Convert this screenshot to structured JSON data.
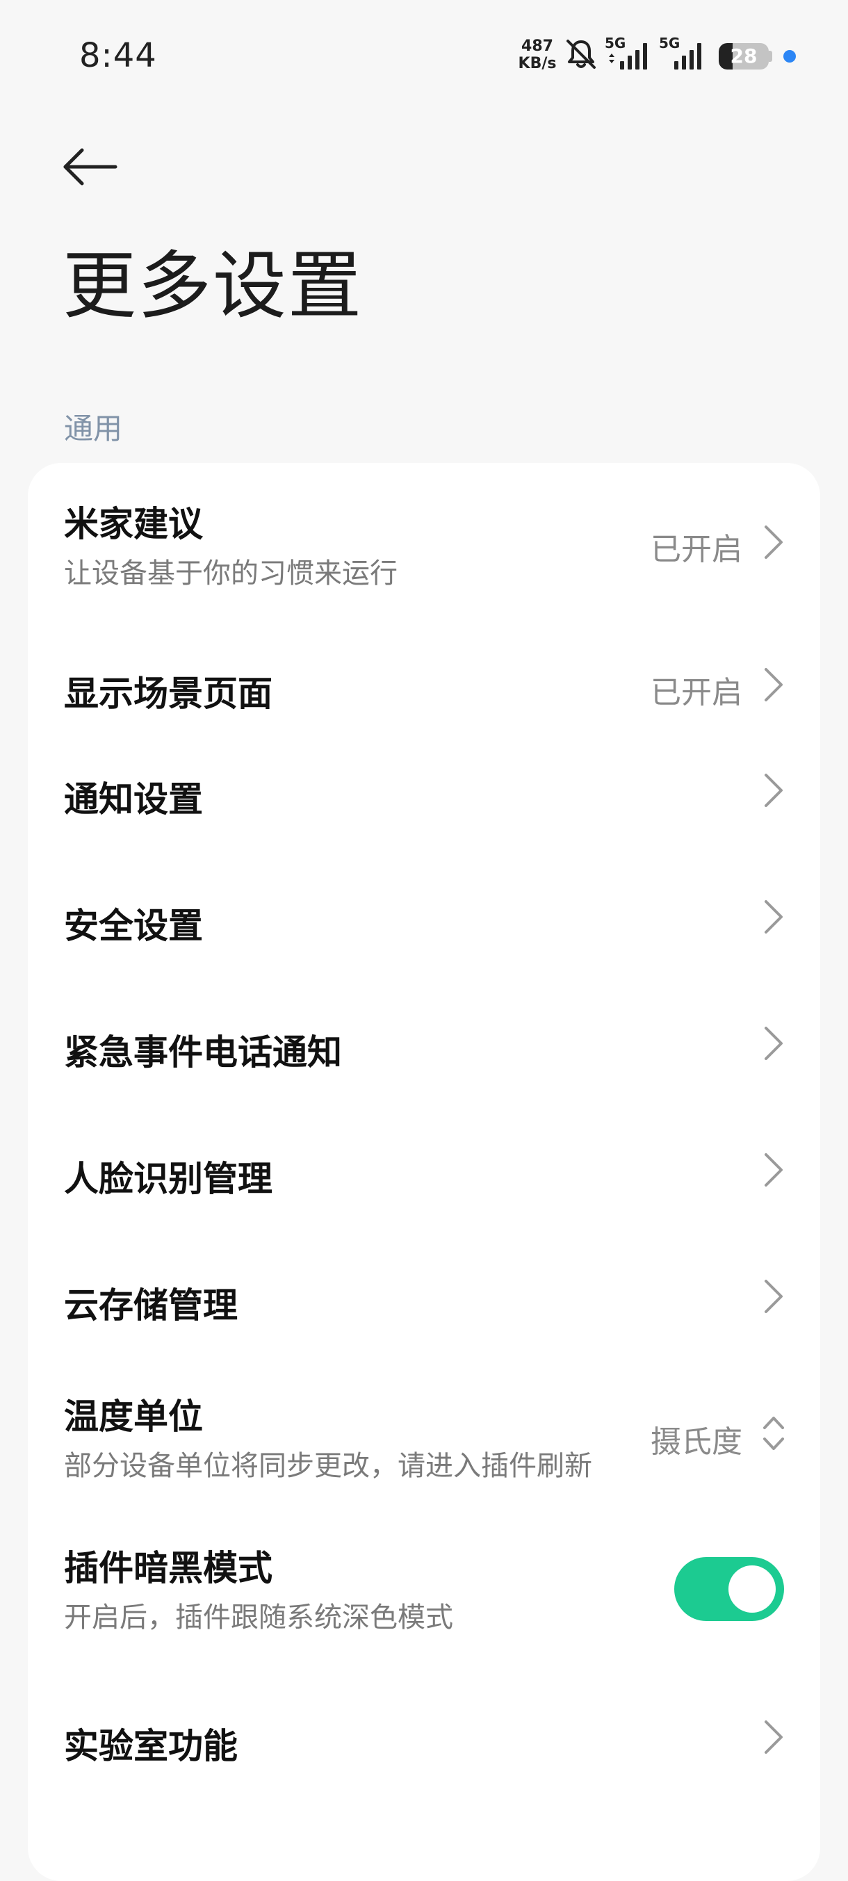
{
  "status_bar": {
    "time": "8:44",
    "net_speed_value": "487",
    "net_speed_unit": "KB/s",
    "sim1_label": "5G",
    "sim2_label": "5G",
    "battery_level": "28",
    "battery_fraction": 0.28,
    "accent_dot_color": "#2c86f5",
    "icons": [
      "bell-off-icon",
      "signal-icon",
      "signal-icon",
      "battery-icon"
    ]
  },
  "header": {
    "back_icon": "arrow-left-icon",
    "title": "更多设置"
  },
  "section": {
    "label": "通用"
  },
  "rows": [
    {
      "title": "米家建议",
      "subtitle": "让设备基于你的习惯来运行",
      "value": "已开启",
      "control": "chevron"
    },
    {
      "title": "显示场景页面",
      "value": "已开启",
      "control": "chevron"
    },
    {
      "title": "通知设置",
      "control": "chevron"
    },
    {
      "title": "安全设置",
      "control": "chevron"
    },
    {
      "title": "紧急事件电话通知",
      "control": "chevron"
    },
    {
      "title": "人脸识别管理",
      "control": "chevron"
    },
    {
      "title": "云存储管理",
      "control": "chevron"
    },
    {
      "title": "温度单位",
      "subtitle": "部分设备单位将同步更改，请进入插件刷新",
      "value": "摄氏度",
      "control": "updown"
    },
    {
      "title": "插件暗黑模式",
      "subtitle": "开启后，插件跟随系统深色模式",
      "control": "toggle",
      "toggle_on": true
    },
    {
      "title": "实验室功能",
      "control": "chevron"
    }
  ],
  "colors": {
    "background": "#f7f7f7",
    "card": "#ffffff",
    "section_label": "#8193a8",
    "toggle_on": "#1ccb91"
  }
}
